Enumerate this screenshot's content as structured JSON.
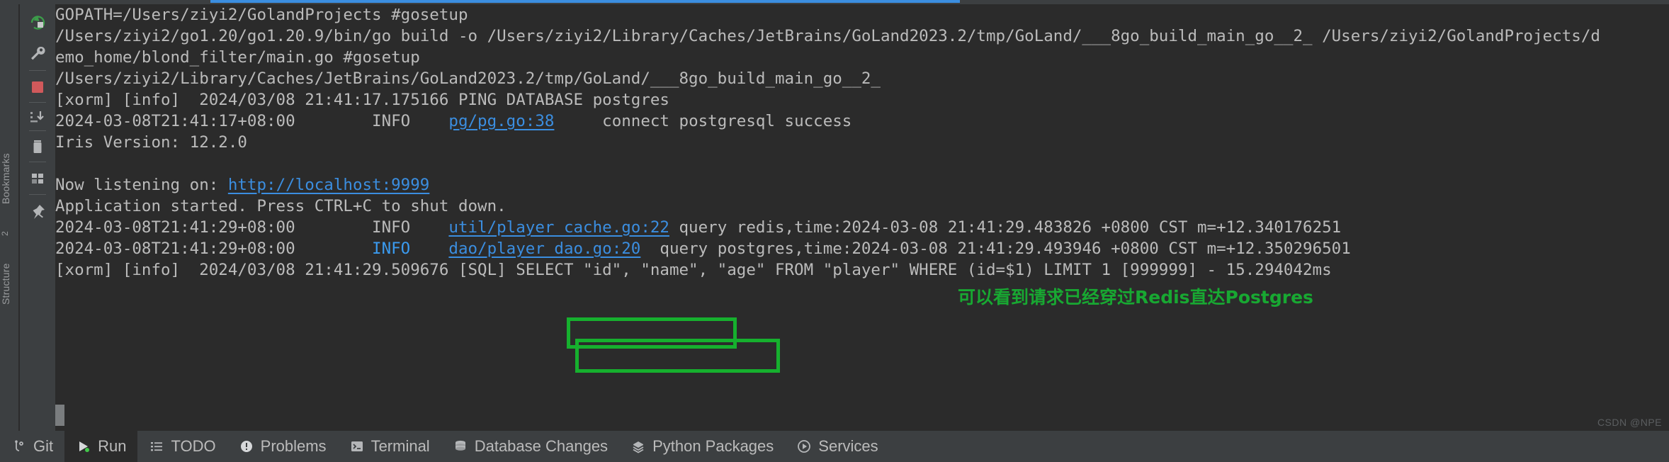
{
  "window": {
    "accent_blue": "#3b8ee0",
    "annotation_green": "#16b02e",
    "console_bg": "#2b2b2b",
    "chrome_bg": "#3c3f41",
    "text_color": "#bbbbbb"
  },
  "left_rail": {
    "labels": [
      "Bookmarks",
      "Structure",
      "2"
    ],
    "icons": [
      {
        "name": "rerun-icon",
        "title": "Rerun"
      },
      {
        "name": "wrench-icon",
        "title": "Edit Configuration"
      },
      {
        "name": "stop-icon",
        "title": "Stop"
      },
      {
        "name": "scroll-to-end-icon",
        "title": "Scroll to End"
      },
      {
        "name": "trash-icon",
        "title": "Clear All"
      },
      {
        "name": "layout-icon",
        "title": "Layout"
      },
      {
        "name": "pin-icon",
        "title": "Pin Tab"
      }
    ]
  },
  "console": {
    "lines": [
      {
        "id": "l1",
        "segments": [
          {
            "t": "GOPATH=/Users/ziyi2/GolandProjects #gosetup",
            "style": "plain"
          }
        ]
      },
      {
        "id": "l2",
        "segments": [
          {
            "t": "/Users/ziyi2/go1.20/go1.20.9/bin/go build -o /Users/ziyi2/Library/Caches/JetBrains/GoLand2023.2/tmp/GoLand/___8go_build_main_go__2_ /Users/ziyi2/GolandProjects/d",
            "style": "plain"
          }
        ]
      },
      {
        "id": "l3",
        "segments": [
          {
            "t": "emo_home/blond_filter/main.go #gosetup",
            "style": "plain"
          }
        ]
      },
      {
        "id": "l4",
        "segments": [
          {
            "t": "/Users/ziyi2/Library/Caches/JetBrains/GoLand2023.2/tmp/GoLand/___8go_build_main_go__2_",
            "style": "plain"
          }
        ]
      },
      {
        "id": "l5",
        "segments": [
          {
            "t": "[xorm] [info]  2024/03/08 21:41:17.175166 PING DATABASE postgres",
            "style": "plain"
          }
        ]
      },
      {
        "id": "l6",
        "segments": [
          {
            "t": "2024-03-08T21:41:17+08:00",
            "style": "plain"
          },
          {
            "t": "        INFO    ",
            "style": "plain"
          },
          {
            "t": "pg/pg.go:38",
            "style": "link"
          },
          {
            "t": "     connect postgresql success",
            "style": "plain"
          }
        ]
      },
      {
        "id": "l7",
        "segments": [
          {
            "t": "Iris Version: 12.2.0",
            "style": "plain"
          }
        ]
      },
      {
        "id": "l8",
        "segments": [
          {
            "t": "",
            "style": "plain"
          }
        ]
      },
      {
        "id": "l9",
        "segments": [
          {
            "t": "Now listening on: ",
            "style": "plain"
          },
          {
            "t": "http://localhost:9999",
            "style": "link"
          }
        ]
      },
      {
        "id": "l10",
        "segments": [
          {
            "t": "Application started. Press CTRL+C to shut down.",
            "style": "plain"
          }
        ]
      },
      {
        "id": "l11",
        "segments": [
          {
            "t": "2024-03-08T21:41:29+08:00",
            "style": "plain"
          },
          {
            "t": "        INFO    ",
            "style": "plain"
          },
          {
            "t": "util/player_cache.go:22",
            "style": "link"
          },
          {
            "t": " query redis,",
            "style": "plain"
          },
          {
            "t": "time:2024-03-08 21:41:29.483826 +0800 CST m=+12.340176251",
            "style": "plain"
          }
        ]
      },
      {
        "id": "l12",
        "segments": [
          {
            "t": "2024-03-08T21:41:29+08:00",
            "style": "plain"
          },
          {
            "t": "        ",
            "style": "plain"
          },
          {
            "t": "INFO",
            "style": "info-blue"
          },
          {
            "t": "    ",
            "style": "plain"
          },
          {
            "t": "dao/player_dao.go:20",
            "style": "link"
          },
          {
            "t": "  query postgres,",
            "style": "plain"
          },
          {
            "t": "time:2024-03-08 21:41:29.493946 +0800 CST m=+12.350296501",
            "style": "plain"
          }
        ]
      },
      {
        "id": "l13",
        "segments": [
          {
            "t": "[xorm] [info]  2024/03/08 21:41:29.509676 [SQL] SELECT \"id\", \"name\", \"age\" FROM \"player\" WHERE (id=$1) LIMIT 1 [999999] - 15.294042ms",
            "style": "plain"
          }
        ]
      }
    ]
  },
  "annotations": {
    "green_note": "可以看到请求已经穿过Redis直达Postgres",
    "highlight_1_text": "query redis,",
    "highlight_2_text": "query postgres,"
  },
  "statusbar": {
    "tabs": [
      {
        "label": "Git",
        "icon": "git-branch-icon",
        "active": false
      },
      {
        "label": "Run",
        "icon": "run-play-icon",
        "active": true
      },
      {
        "label": "TODO",
        "icon": "todo-list-icon",
        "active": false
      },
      {
        "label": "Problems",
        "icon": "problems-warning-icon",
        "active": false
      },
      {
        "label": "Terminal",
        "icon": "terminal-icon",
        "active": false
      },
      {
        "label": "Database Changes",
        "icon": "database-icon",
        "active": false
      },
      {
        "label": "Python Packages",
        "icon": "python-packages-icon",
        "active": false
      },
      {
        "label": "Services",
        "icon": "services-icon",
        "active": false
      }
    ]
  },
  "watermark": "CSDN @NPE"
}
